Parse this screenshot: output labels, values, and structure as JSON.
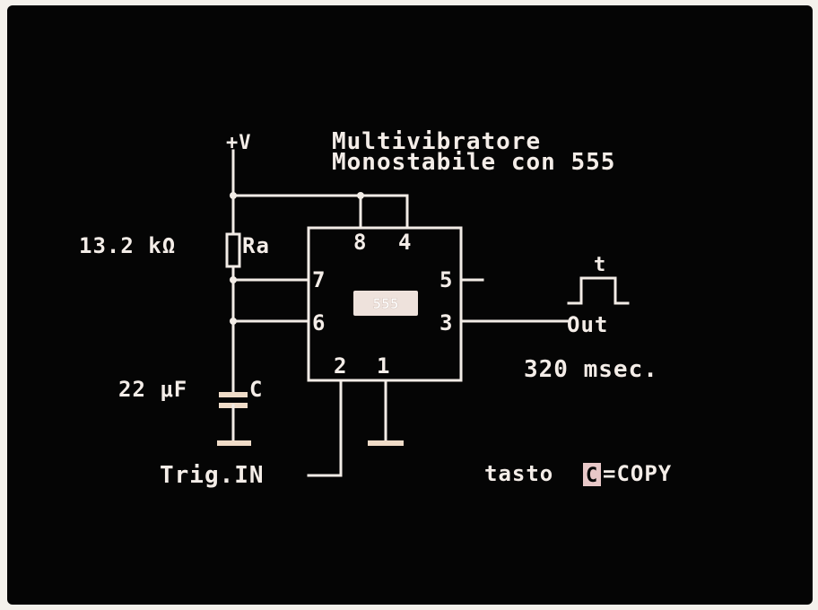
{
  "title": {
    "line1": "Multivibratore",
    "line2": "Monostabile con 555"
  },
  "circuit": {
    "supply_label": "+V",
    "resistor_value": "13.2 kΩ",
    "resistor_name": "Ra",
    "capacitor_value": "22 μF",
    "capacitor_name": "C",
    "chip_label": "555",
    "pins": {
      "p8": "8",
      "p4": "4",
      "p7": "7",
      "p5": "5",
      "p6": "6",
      "p3": "3",
      "p2": "2",
      "p1": "1"
    },
    "pulse_label": "t",
    "output_label": "Out",
    "pulse_duration": "320 msec.",
    "trigger_label": "Trig.IN"
  },
  "footer": {
    "key_prefix": "tasto",
    "key": "C",
    "key_suffix": "=COPY"
  },
  "colors": {
    "background": "#050505",
    "foreground": "#f4ede8",
    "key_highlight": "#e8c8c8"
  }
}
